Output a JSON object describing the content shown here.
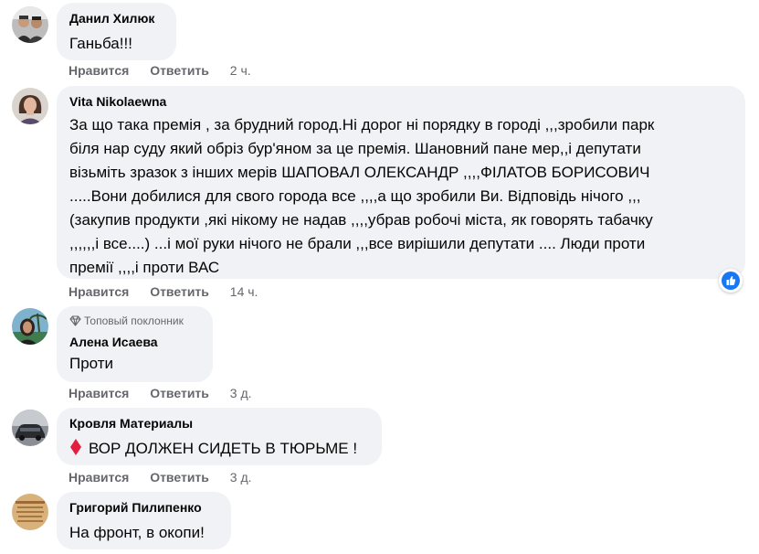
{
  "comments": [
    {
      "author": "Данил Хилюк",
      "text": "Ганьба!!!",
      "like": "Нравится",
      "reply": "Ответить",
      "time": "2 ч."
    },
    {
      "author": "Vita Nikolaewna",
      "text_lines": [
        "За що така премія , за брудний город.Ні дорог ні порядку в городі ,,,зробили парк",
        "біля нар суду який обріз бур'яном за це премія. Шановний пане мер,,і депутати",
        "візьміть зразок з інших мерів ШАПОВАЛ ОЛЕКСАНДР ,,,,ФІЛАТОВ БОРИСОВИЧ",
        ".....Вони добилися для свого города все ,,,,а що зробили Ви. Відповідь нічого ,,,",
        "(закупив продукти ,які нікому не надав ,,,,убрав робочі міста, як говорять табачку",
        ",,,,,,і все....) ...і мої руки нічого не брали ,,,все вирішили депутати .... Люди проти",
        "премії ,,,,і проти ВАС"
      ],
      "like": "Нравится",
      "reply": "Ответить",
      "time": "14 ч.",
      "reaction_icon": "like-icon"
    },
    {
      "badge": "Топовый поклонник",
      "badge_icon": "diamond-icon",
      "author": "Алена Исаева",
      "text": "Проти",
      "like": "Нравится",
      "reply": "Ответить",
      "time": "3 д."
    },
    {
      "author": "Кровля Материалы",
      "text_icon": "red-diamond-icon",
      "text": "ВОР ДОЛЖЕН СИДЕТЬ В ТЮРЬМЕ !",
      "like": "Нравится",
      "reply": "Ответить",
      "time": "3 д."
    },
    {
      "author": "Григорий Пилипенко",
      "text": "На фронт, в окопи!"
    }
  ],
  "colors": {
    "bubble": "#f0f2f5",
    "secondary_text": "#65676b",
    "like_blue": "#1877f2",
    "diamond_red": "#e41e3f"
  }
}
